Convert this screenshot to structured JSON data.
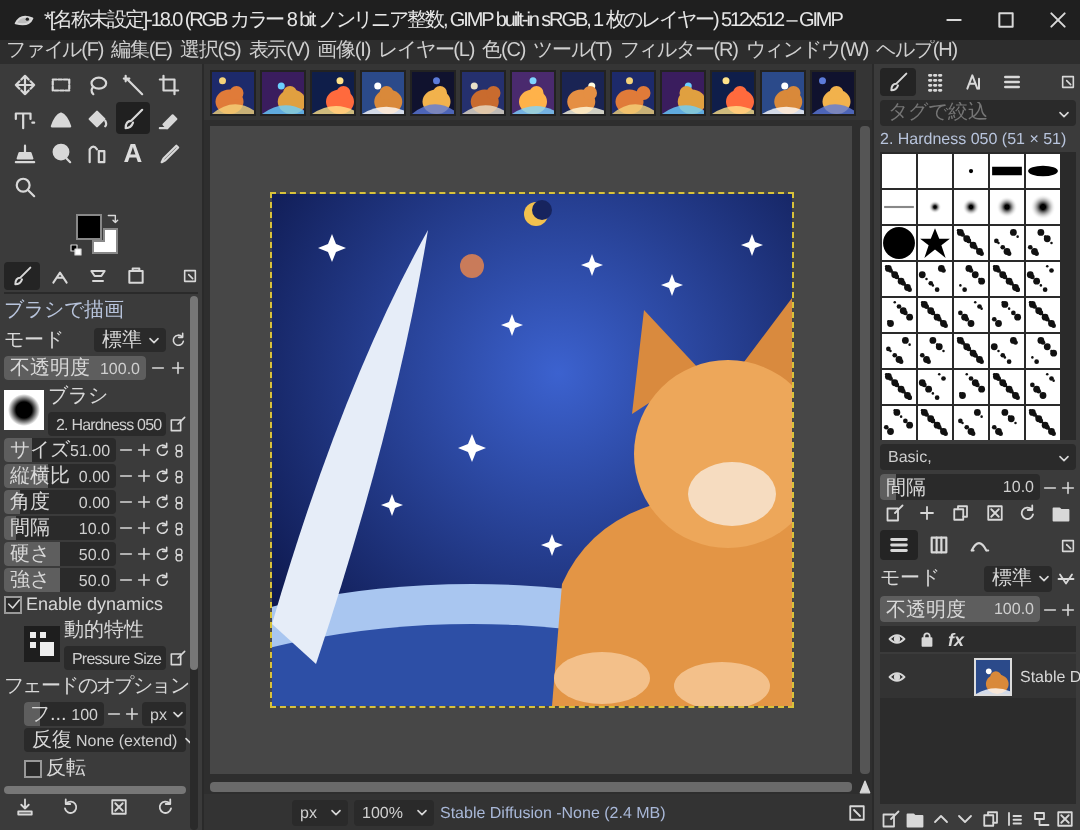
{
  "window": {
    "title": "*[名称未設定]-18.0 (RGB カラー 8 bit ノンリニア整数, GIMP built-in sRGB, 1 枚のレイヤー) 512x512 – GIMP"
  },
  "menu": [
    "ファイル(F)",
    "編集(E)",
    "選択(S)",
    "表示(V)",
    "画像(I)",
    "レイヤー(L)",
    "色(C)",
    "ツール(T)",
    "フィルター(R)",
    "ウィンドウ(W)",
    "ヘルプ(H)"
  ],
  "toolbox": {
    "tools": [
      {
        "selected": false
      },
      {
        "selected": false
      },
      {
        "selected": false
      },
      {
        "selected": false
      },
      {
        "selected": false
      },
      {
        "selected": false
      },
      {
        "selected": false
      },
      {
        "selected": false
      },
      {
        "selected": true
      },
      {
        "selected": false
      },
      {
        "selected": false
      },
      {
        "selected": false
      },
      {
        "selected": false
      },
      {
        "selected": false,
        "glyph": "A"
      },
      {
        "selected": false
      },
      {
        "selected": false
      }
    ]
  },
  "left_dock_tabs": [
    {
      "selected": true
    },
    {
      "selected": false
    },
    {
      "selected": false
    },
    {
      "selected": false
    }
  ],
  "tool_options": {
    "title": "ブラシで描画",
    "mode": {
      "label": "モード",
      "value": "標準"
    },
    "opacity": {
      "label": "不透明度",
      "value": "100.0",
      "level": 1.0
    },
    "brush": {
      "label": "ブラシ",
      "value": "2. Hardness 050"
    },
    "sliders": [
      {
        "label": "サイズ",
        "value": "51.00",
        "level": 0.25,
        "linked": true
      },
      {
        "label": "縦横比",
        "value": "0.00",
        "level": 0.4,
        "linked": true
      },
      {
        "label": "角度",
        "value": "0.00",
        "level": 0.15,
        "linked": true
      },
      {
        "label": "間隔",
        "value": "10.0",
        "level": 0.1,
        "linked": true
      },
      {
        "label": "硬さ",
        "value": "50.0",
        "level": 0.5,
        "linked": true
      },
      {
        "label": "強さ",
        "value": "50.0",
        "level": 0.5,
        "linked": false
      }
    ],
    "enable_dynamics": {
      "label": "Enable dynamics",
      "checked": true
    },
    "dynamics": {
      "label": "動的特性",
      "value": "Pressure Size"
    },
    "fade": {
      "title": "フェードのオプション",
      "length": {
        "label": "フ...",
        "value": "100",
        "level": 0.2,
        "unit": "px"
      },
      "repeat": {
        "label": "反復",
        "value": "None (extend)"
      },
      "reverse": {
        "label": "反転",
        "checked": false
      }
    }
  },
  "image_tabs": [
    {
      "kind": "picture"
    },
    {
      "kind": "picture"
    },
    {
      "kind": "picture"
    },
    {
      "kind": "picture"
    },
    {
      "kind": "picture"
    },
    {
      "kind": "picture"
    },
    {
      "kind": "picture"
    },
    {
      "kind": "picture"
    },
    {
      "kind": "picture"
    },
    {
      "kind": "picture"
    },
    {
      "kind": "picture"
    },
    {
      "kind": "picture"
    },
    {
      "kind": "picture"
    }
  ],
  "canvas": {
    "kind": "picture"
  },
  "status_bar": {
    "unit": "px",
    "zoom": "100%",
    "message": "Stable Diffusion -None (2.4 MB)"
  },
  "brushes": {
    "tabs": [
      {
        "selected": true
      },
      {
        "selected": false
      },
      {
        "selected": false
      },
      {
        "selected": false
      }
    ],
    "filter_placeholder": "タグで絞込",
    "brush_name": "2. Hardness 050 (51 × 51)",
    "tag": "Basic,",
    "spacing": {
      "label": "間隔",
      "value": "10.0",
      "level": 0.1
    }
  },
  "layers": {
    "tabs": [
      {
        "selected": true
      },
      {
        "selected": false
      },
      {
        "selected": false
      }
    ],
    "mode": {
      "label": "モード",
      "value": "標準"
    },
    "opacity": {
      "label": "不透明度",
      "value": "100.0",
      "level": 1.0
    },
    "header_effects": "fx",
    "items": [
      {
        "name": "Stable D",
        "visible": true,
        "kind": "picture"
      }
    ]
  }
}
